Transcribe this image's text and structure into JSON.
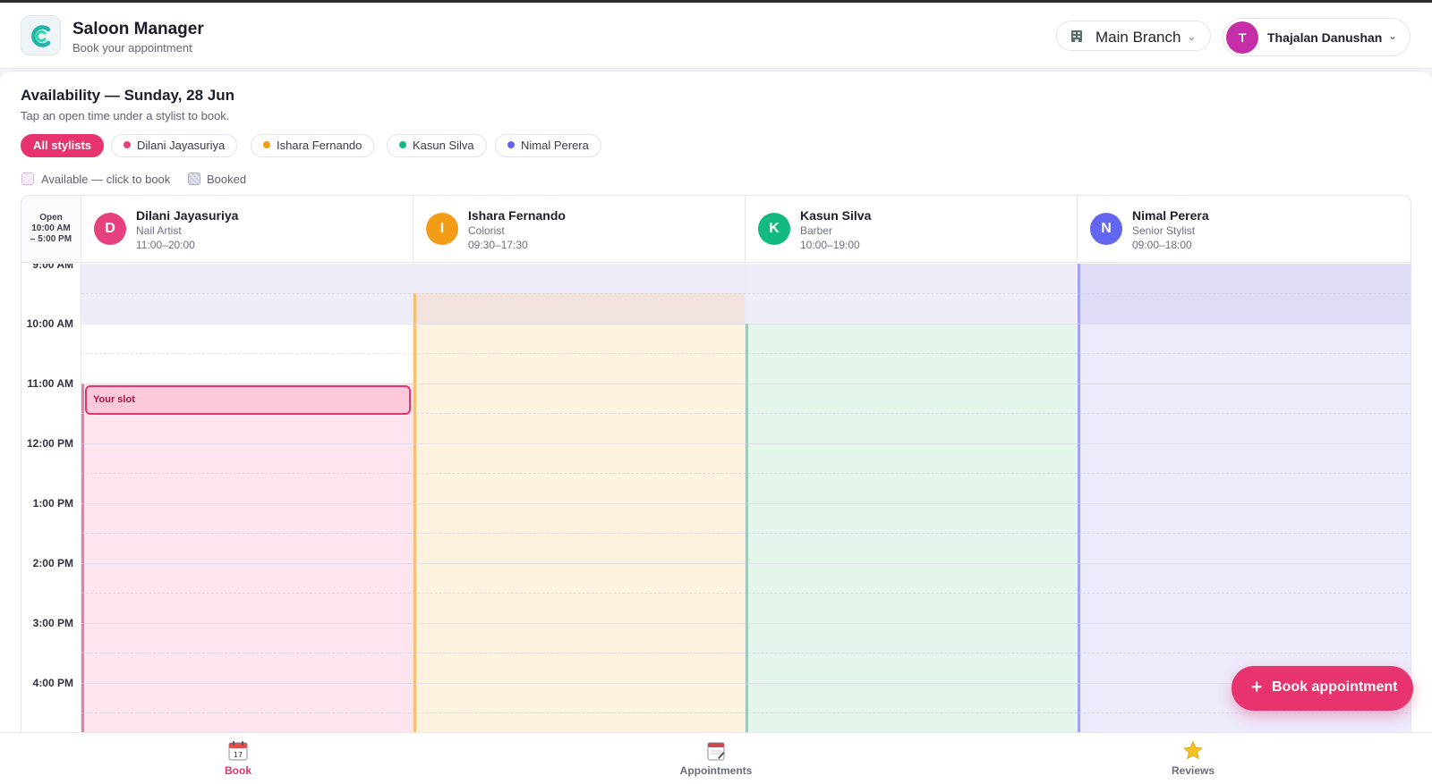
{
  "app": {
    "title": "Saloon Manager",
    "subtitle": "Book your appointment"
  },
  "header": {
    "branch": "Main Branch",
    "user_initial": "T",
    "user_name": "Thajalan Danushan"
  },
  "availability": {
    "title": "Availability — Sunday, 28 Jun",
    "subtitle": "Tap an open time under a stylist to book."
  },
  "filters": [
    {
      "label": "All stylists",
      "active": true
    },
    {
      "label": "Dilani Jayasuriya",
      "color": "#e7407f"
    },
    {
      "label": "Ishara Fernando",
      "color": "#f29c18"
    },
    {
      "label": "Kasun Silva",
      "color": "#12b981"
    },
    {
      "label": "Nimal Perera",
      "color": "#6366f1"
    }
  ],
  "legend": {
    "available": "Available — click to book",
    "booked": "Booked"
  },
  "open_hours": {
    "label": "Open",
    "range_start": "10:00 AM",
    "range_end": "– 5:00 PM"
  },
  "stylists": [
    {
      "initial": "D",
      "name": "Dilani Jayasuriya",
      "role": "Nail Artist",
      "hours": "11:00–20:00",
      "color": "#e7407f"
    },
    {
      "initial": "I",
      "name": "Ishara Fernando",
      "role": "Colorist",
      "hours": "09:30–17:30",
      "color": "#f29c18"
    },
    {
      "initial": "K",
      "name": "Kasun Silva",
      "role": "Barber",
      "hours": "10:00–19:00",
      "color": "#12b981"
    },
    {
      "initial": "N",
      "name": "Nimal Perera",
      "role": "Senior Stylist",
      "hours": "09:00–18:00",
      "color": "#6366f1"
    }
  ],
  "times": [
    "9:00 AM",
    "10:00 AM",
    "11:00 AM",
    "12:00 PM",
    "1:00 PM",
    "2:00 PM",
    "3:00 PM",
    "4:00 PM"
  ],
  "selected_slot": "Your slot",
  "fab": {
    "label": "Book appointment"
  },
  "nav": [
    {
      "label": "Book",
      "icon": "calendar-icon",
      "active": true,
      "calendar_day": "17"
    },
    {
      "label": "Appointments",
      "icon": "notepad-icon",
      "active": false
    },
    {
      "label": "Reviews",
      "icon": "star-icon",
      "active": false
    }
  ]
}
